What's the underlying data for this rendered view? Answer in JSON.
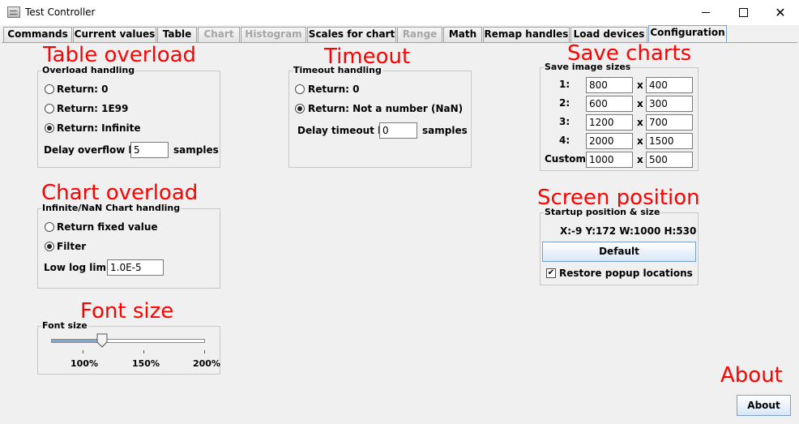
{
  "window": {
    "title": "Test Controller"
  },
  "tabs": [
    {
      "label": "Commands",
      "state": "normal"
    },
    {
      "label": "Current values",
      "state": "normal"
    },
    {
      "label": "Table",
      "state": "normal"
    },
    {
      "label": "Chart",
      "state": "disabled"
    },
    {
      "label": "Histogram",
      "state": "disabled"
    },
    {
      "label": "Scales for chart",
      "state": "normal"
    },
    {
      "label": "Range",
      "state": "disabled"
    },
    {
      "label": "Math",
      "state": "normal"
    },
    {
      "label": "Remap handles",
      "state": "normal"
    },
    {
      "label": "Load devices",
      "state": "normal"
    },
    {
      "label": "Configuration",
      "state": "active"
    }
  ],
  "annotations": {
    "table_overload": "Table overload",
    "timeout": "Timeout",
    "save_charts": "Save charts",
    "chart_overload": "Chart overload",
    "screen_position": "Screen position",
    "font_size": "Font size",
    "about": "About"
  },
  "overload": {
    "title": "Overload handling",
    "options": [
      "Return: 0",
      "Return: 1E99",
      "Return: Infinite"
    ],
    "selected": 2,
    "delay_label": "Delay overflow by:",
    "delay_value": "5",
    "delay_unit": "samples"
  },
  "timeout": {
    "title": "Timeout handling",
    "options": [
      "Return: 0",
      "Return: Not a number (NaN)"
    ],
    "selected": 1,
    "delay_label": "Delay timeout by:",
    "delay_value": "0",
    "delay_unit": "samples"
  },
  "save_sizes": {
    "title": "Save image sizes",
    "separator": "x",
    "rows": [
      {
        "label": "1:",
        "w": "800",
        "h": "400"
      },
      {
        "label": "2:",
        "w": "600",
        "h": "300"
      },
      {
        "label": "3:",
        "w": "1200",
        "h": "700"
      },
      {
        "label": "4:",
        "w": "2000",
        "h": "1500"
      },
      {
        "label": "Custom:",
        "w": "1000",
        "h": "500"
      }
    ]
  },
  "chart_overload": {
    "title": "Infinite/NaN Chart handling",
    "options": [
      "Return fixed value",
      "Filter"
    ],
    "selected": 1,
    "log_label": "Low log limit:",
    "log_value": "1.0E-5"
  },
  "startup": {
    "title": "Startup position & size",
    "info": "X:-9  Y:172  W:1000  H:530",
    "default_button": "Default",
    "restore_label": "Restore popup locations",
    "restore_checked": true
  },
  "font_size": {
    "title": "Font size",
    "ticks": [
      "100%",
      "150%",
      "200%"
    ],
    "value_percent": 100
  },
  "about_button": "About"
}
